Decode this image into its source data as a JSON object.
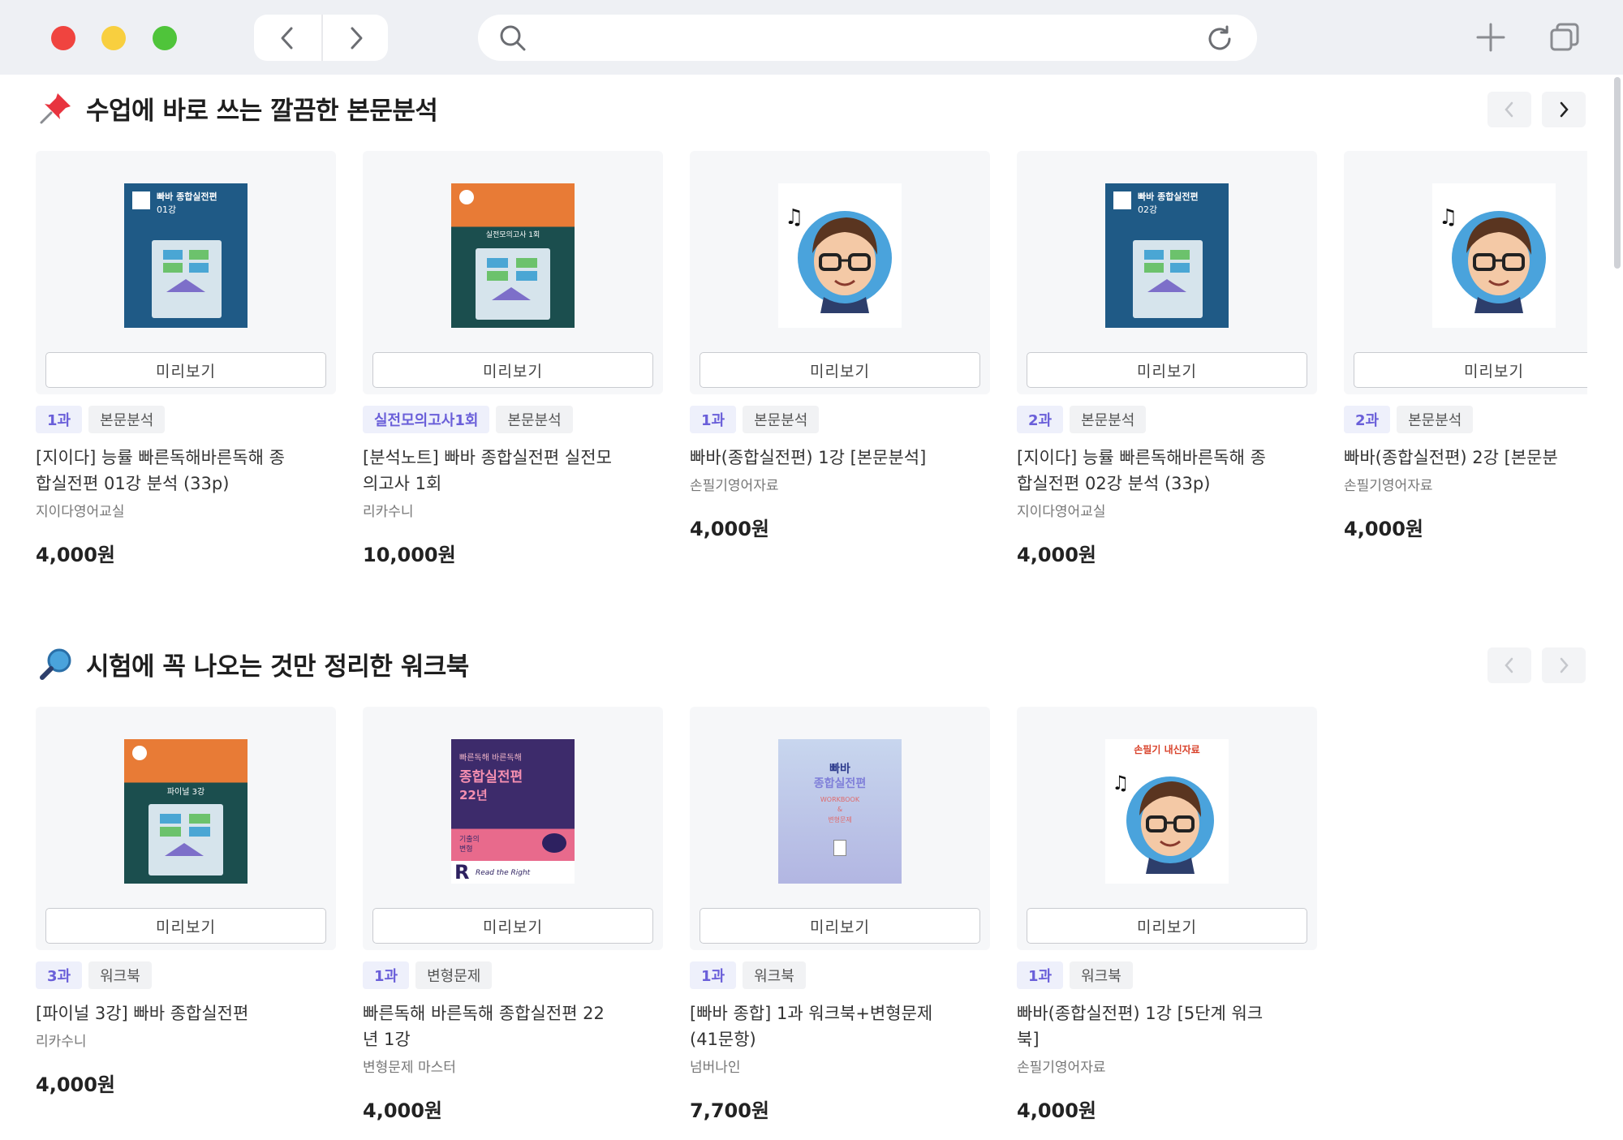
{
  "browser": {
    "address_placeholder": ""
  },
  "sections": [
    {
      "title": "수업에 바로 쓰는 깔끔한 본문분석",
      "icon": "pushpin-icon",
      "cards": [
        {
          "tags": [
            "1과",
            "본문분석"
          ],
          "title": "[지이다] 능률 빠른독해바른독해 종\n합실전편 01강 분석 (33p)",
          "seller": "지이다영어교실",
          "price": "4,000원",
          "cover": "blue-01"
        },
        {
          "tags": [
            "실전모의고사1회",
            "본문분석"
          ],
          "title": "[분석노트] 빠바 종합실전편 실전모\n의고사 1회",
          "seller": "리카수니",
          "price": "10,000원",
          "cover": "teal-exam"
        },
        {
          "tags": [
            "1과",
            "본문분석"
          ],
          "title": "빠바(종합실전편) 1강 [본문분석]",
          "seller": "손필기영어자료",
          "price": "4,000원",
          "cover": "avatar"
        },
        {
          "tags": [
            "2과",
            "본문분석"
          ],
          "title": "[지이다] 능률 빠른독해바른독해 종\n합실전편 02강 분석 (33p)",
          "seller": "지이다영어교실",
          "price": "4,000원",
          "cover": "blue-02"
        },
        {
          "tags": [
            "2과",
            "본문분석"
          ],
          "title": "빠바(종합실전편) 2강 [본문분",
          "seller": "손필기영어자료",
          "price": "4,000원",
          "cover": "avatar"
        }
      ]
    },
    {
      "title": "시험에 꼭 나오는 것만 정리한 워크북",
      "icon": "magnifier-icon",
      "cards": [
        {
          "tags": [
            "3과",
            "워크북"
          ],
          "title": "[파이널 3강] 빠바 종합실전편",
          "seller": "리카수니",
          "price": "4,000원",
          "cover": "teal-final"
        },
        {
          "tags": [
            "1과",
            "변형문제"
          ],
          "title": "빠른독해 바른독해 종합실전편 22\n년 1강",
          "seller": "변형문제 마스터",
          "price": "4,000원",
          "cover": "purple-22"
        },
        {
          "tags": [
            "1과",
            "워크북"
          ],
          "title": "[빠바 종합] 1과 워크북+변형문제\n(41문항)",
          "seller": "넘버나인",
          "price": "7,700원",
          "cover": "light-workbook"
        },
        {
          "tags": [
            "1과",
            "워크북"
          ],
          "title": "빠바(종합실전편) 1강 [5단계 워크\n북]",
          "seller": "손필기영어자료",
          "price": "4,000원",
          "cover": "avatar-label"
        }
      ]
    }
  ],
  "labels": {
    "preview": "미리보기"
  },
  "covers": {
    "blue_01": {
      "line1": "빠바 종합실전편",
      "line2": "01강"
    },
    "blue_02": {
      "line1": "빠바 종합실전편",
      "line2": "02강"
    },
    "teal_exam": {
      "line": "실전모의고사 1회"
    },
    "teal_final": {
      "line": "파이널 3강"
    },
    "purple_22": {
      "line1": "빠른독해 바른독해",
      "line2": "종합실전편",
      "line3": "22년",
      "line4": "기출의",
      "line5": "변형",
      "line6": "Read the Right"
    },
    "light_workbook": {
      "line1": "빠바",
      "line2": "종합실전편",
      "line3": "WORKBOOK",
      "line4": "&",
      "line5": "변형문제"
    },
    "avatar_label": {
      "line": "손필기 내신자료"
    }
  },
  "colors": {
    "tag_primary": "#6a5fd9",
    "accent_blue": "#1f5a86",
    "accent_teal": "#1b4e4e",
    "accent_orange": "#e87b36"
  }
}
